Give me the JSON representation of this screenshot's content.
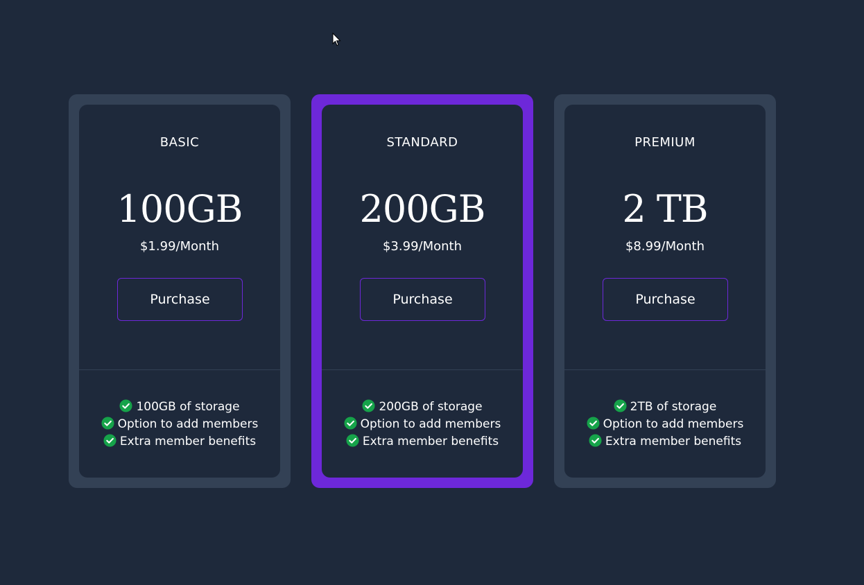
{
  "colors": {
    "background": "#1e293b",
    "card_frame": "#334155",
    "highlight_frame": "#6d28d9",
    "button_border": "#6d28d9",
    "check": "#16a34a"
  },
  "plans": [
    {
      "tier": "BASIC",
      "storage": "100GB",
      "price": "$1.99/Month",
      "button_label": "Purchase",
      "highlighted": false,
      "features": [
        "100GB of storage",
        "Option to add members",
        "Extra member benefits"
      ]
    },
    {
      "tier": "STANDARD",
      "storage": "200GB",
      "price": "$3.99/Month",
      "button_label": "Purchase",
      "highlighted": true,
      "features": [
        "200GB of storage",
        "Option to add members",
        "Extra member benefits"
      ]
    },
    {
      "tier": "PREMIUM",
      "storage": "2 TB",
      "price": "$8.99/Month",
      "button_label": "Purchase",
      "highlighted": false,
      "features": [
        "2TB of storage",
        "Option to add members",
        "Extra member benefits"
      ]
    }
  ]
}
